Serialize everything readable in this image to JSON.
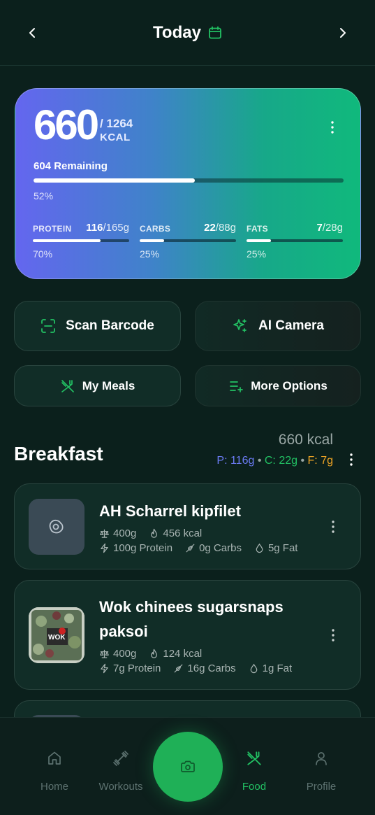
{
  "header": {
    "title": "Today",
    "prev_icon": "chevron-left-icon",
    "next_icon": "chevron-right-icon",
    "calendar_icon": "calendar-icon"
  },
  "summary": {
    "consumed": "660",
    "goal": "/ 1264",
    "unit": "KCAL",
    "remaining": "604 Remaining",
    "progress_percent": 52,
    "progress_label": "52%",
    "macros": [
      {
        "label": "PROTEIN",
        "current": "116",
        "target": "/165g",
        "percent": 70,
        "percent_label": "70%"
      },
      {
        "label": "CARBS",
        "current": "22",
        "target": "/88g",
        "percent": 25,
        "percent_label": "25%"
      },
      {
        "label": "FATS",
        "current": "7",
        "target": "/28g",
        "percent": 25,
        "percent_label": "25%"
      }
    ]
  },
  "actions": {
    "scan_barcode": "Scan Barcode",
    "ai_camera": "AI Camera",
    "my_meals": "My Meals",
    "more_options": "More Options"
  },
  "meal": {
    "title": "Breakfast",
    "kcal": "660 kcal",
    "protein": "P: 116g",
    "carbs": "C: 22g",
    "fat": "F: 7g",
    "separator": "•"
  },
  "foods": [
    {
      "name": "AH Scharrel kipfilet",
      "weight": "400g",
      "kcal": "456 kcal",
      "protein": "100g Protein",
      "carbs": "0g Carbs",
      "fat": "5g Fat"
    },
    {
      "name_line1": "Wok chinees sugarsnaps",
      "name_line2": "paksoi",
      "weight": "400g",
      "kcal": "124 kcal",
      "protein": "7g Protein",
      "carbs": "16g Carbs",
      "fat": "1g Fat",
      "package_text": "WOK"
    }
  ],
  "nav": {
    "home": "Home",
    "workouts": "Workouts",
    "food": "Food",
    "profile": "Profile"
  },
  "colors": {
    "accent": "#22c063",
    "protein": "#6c7cf5",
    "carbs": "#22c063",
    "fat": "#f0a524",
    "background": "#0b201c",
    "card_bg": "#112d27"
  }
}
